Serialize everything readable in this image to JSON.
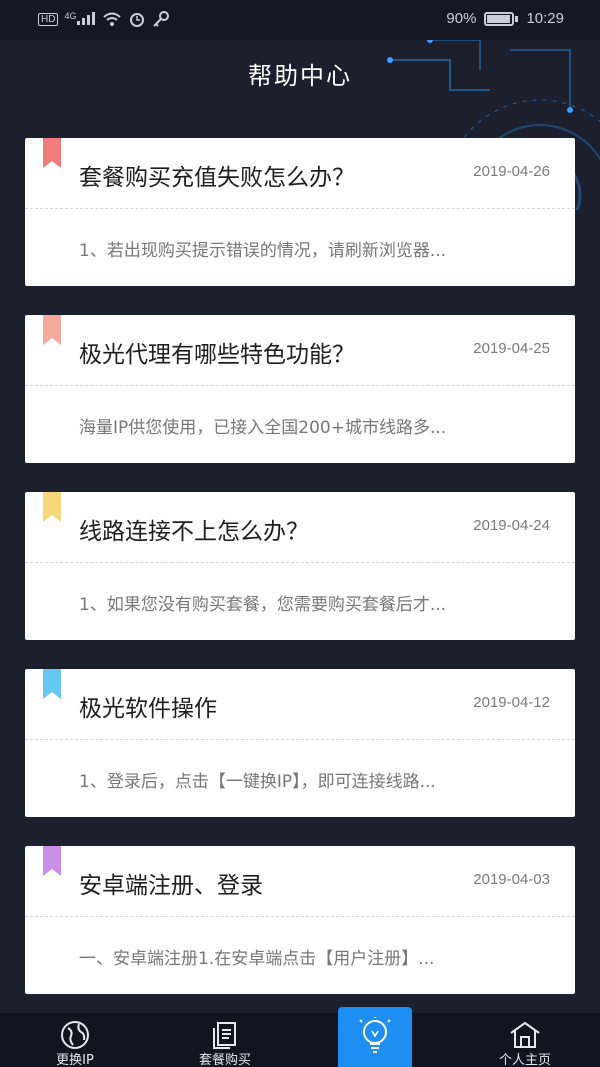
{
  "status_bar": {
    "left_icons": [
      "hd-icon",
      "signal-4g-icon",
      "wifi-icon",
      "alarm-icon",
      "key-icon"
    ],
    "hd_text": "HD",
    "network_text": "4G",
    "battery_percent": "90%",
    "battery_level": 0.9,
    "time": "10:29"
  },
  "header": {
    "title": "帮助中心"
  },
  "cards": [
    {
      "title": "套餐购买充值失败怎么办？",
      "date": "2019-04-26",
      "summary": "1、若出现购买提示错误的情况，请刷新浏览器...",
      "ribbon_color": "#f07c7c"
    },
    {
      "title": "极光代理有哪些特色功能？",
      "date": "2019-04-25",
      "summary": "海量IP供您使用，已接入全国200+城市线路多...",
      "ribbon_color": "#f4a99a"
    },
    {
      "title": "线路连接不上怎么办？",
      "date": "2019-04-24",
      "summary": "1、如果您没有购买套餐，您需要购买套餐后才...",
      "ribbon_color": "#f7d77a"
    },
    {
      "title": "极光软件操作",
      "date": "2019-04-12",
      "summary": "1、登录后，点击【一键换IP】，即可连接线路...",
      "ribbon_color": "#66c7f2"
    },
    {
      "title": "安卓端注册、登录",
      "date": "2019-04-03",
      "summary": "一、安卓端注册1.在安卓端点击【用户注册】...",
      "ribbon_color": "#c98ee8"
    }
  ],
  "tabbar": {
    "tabs": [
      {
        "label": "更换IP",
        "icon": "globe-icon"
      },
      {
        "label": "套餐购买",
        "icon": "document-icon"
      },
      {
        "label": "",
        "icon": "lightbulb-icon",
        "active": true
      },
      {
        "label": "个人主页",
        "icon": "home-icon"
      }
    ]
  },
  "colors": {
    "background": "#1b1f2e",
    "accent": "#1d8ef2",
    "card": "#ffffff"
  }
}
